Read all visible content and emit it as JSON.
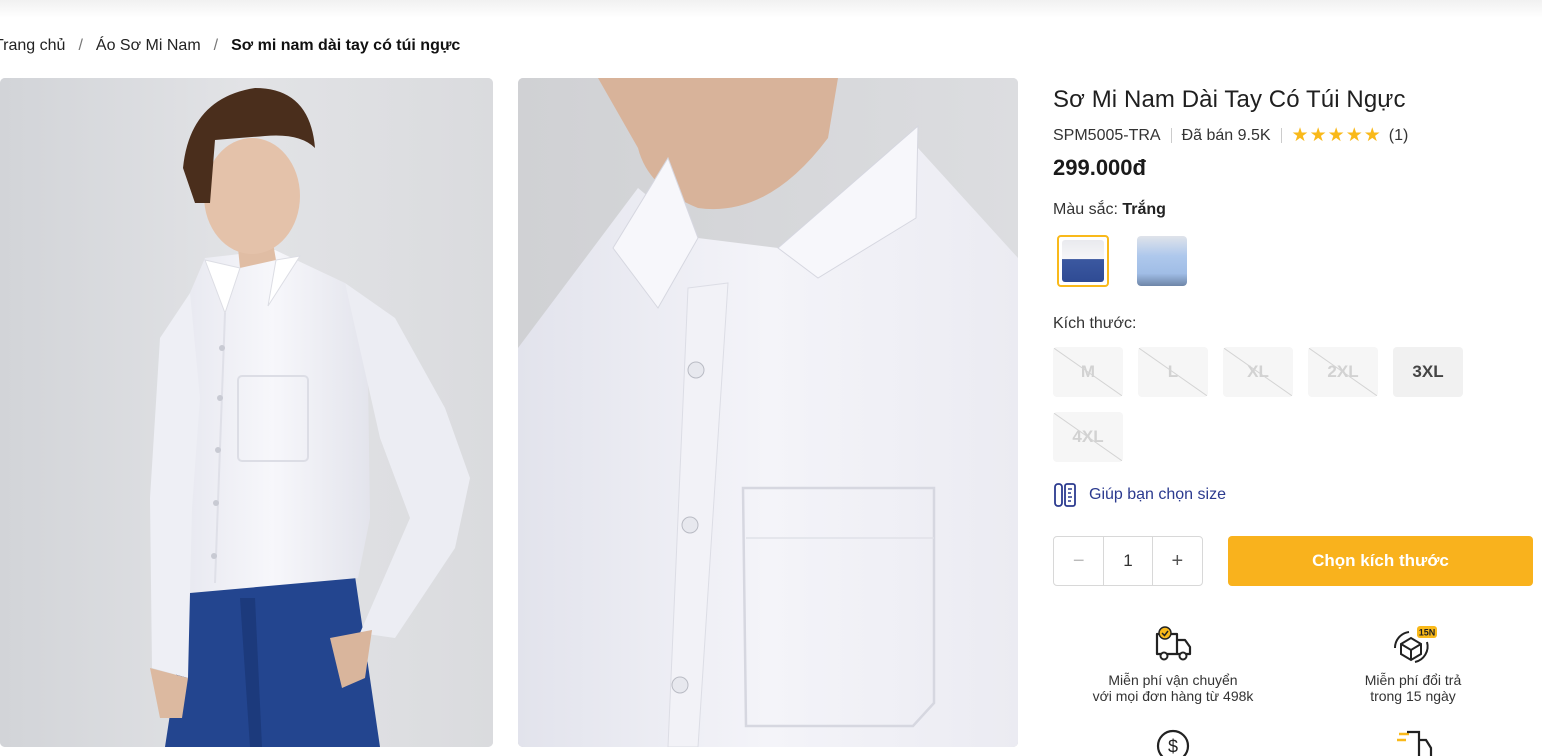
{
  "breadcrumb": {
    "items": [
      "Trang chủ",
      "Áo Sơ Mi Nam"
    ],
    "current": "Sơ mi nam dài tay có túi ngực",
    "separator": "/"
  },
  "product": {
    "title": "Sơ Mi Nam Dài Tay Có Túi Ngực",
    "sku": "SPM5005-TRA",
    "sold": "Đã bán 9.5K",
    "rating_stars": 5,
    "rating_count": "(1)",
    "price": "299.000đ"
  },
  "color": {
    "label": "Màu sắc:",
    "selected": "Trắng",
    "accent": "#f9b91a"
  },
  "size": {
    "label": "Kích thước:",
    "options": [
      {
        "name": "M",
        "available": false
      },
      {
        "name": "L",
        "available": false
      },
      {
        "name": "XL",
        "available": false
      },
      {
        "name": "2XL",
        "available": false
      },
      {
        "name": "3XL",
        "available": true
      },
      {
        "name": "4XL",
        "available": false
      }
    ],
    "guide": "Giúp bạn chọn size"
  },
  "buy": {
    "quantity": "1",
    "minus": "−",
    "plus": "+",
    "cta": "Chọn kích thước",
    "cta_color": "#f9b21d"
  },
  "benefits": [
    {
      "icon": "free-shipping-truck-icon",
      "line1": "Miễn phí vận chuyển",
      "line2": "với mọi đơn hàng từ 498k"
    },
    {
      "icon": "return-box-icon",
      "badge": "15N",
      "line1": "Miễn phí đổi trả",
      "line2": "trong 15 ngày"
    }
  ]
}
